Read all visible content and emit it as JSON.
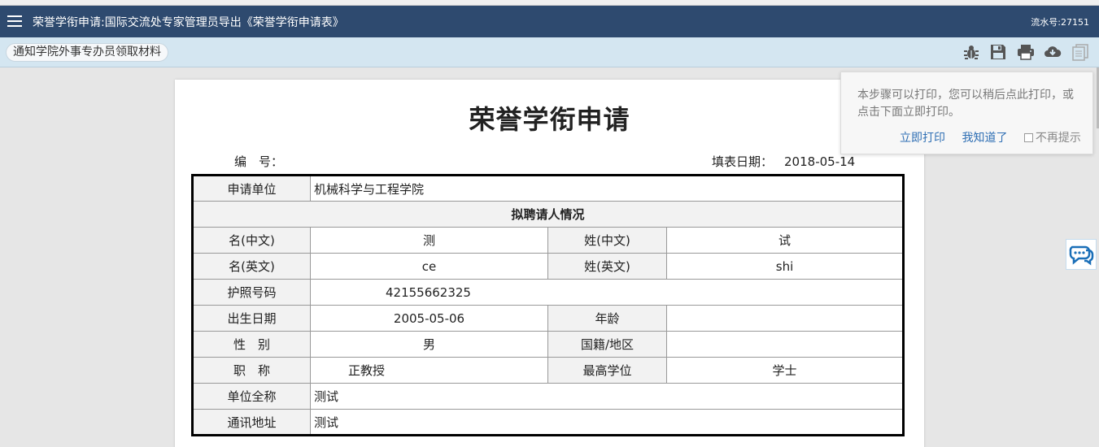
{
  "window": {
    "title": "荣誉学衔申请:国际交流处专家管理员导出《荣誉学衔申请表》",
    "serial": "流水号:27151"
  },
  "toolbar": {
    "notify_label": "通知学院外事专办员领取材料",
    "icons": [
      "bug-icon",
      "save-icon",
      "print-icon",
      "cloud-download-icon",
      "history-icon"
    ]
  },
  "document": {
    "title": "荣誉学衔申请",
    "number_label": "编　号：",
    "number_value": "",
    "date_label": "填表日期：",
    "date_value": "2018-05-14"
  },
  "form": {
    "unit_label": "申请单位",
    "unit_value": "机械科学与工程学院",
    "section_title": "拟聘请人情况",
    "given_cn_label": "名(中文)",
    "given_cn_value": "测",
    "family_cn_label": "姓(中文)",
    "family_cn_value": "试",
    "given_en_label": "名(英文)",
    "given_en_value": "ce",
    "family_en_label": "姓(英文)",
    "family_en_value": "shi",
    "passport_label": "护照号码",
    "passport_value": "42155662325",
    "birth_label": "出生日期",
    "birth_value": "2005-05-06",
    "age_label": "年龄",
    "age_value": "",
    "gender_label": "性　别",
    "gender_value": "男",
    "nationality_label": "国籍/地区",
    "nationality_value": "",
    "title_label": "职　称",
    "title_value": "正教授",
    "degree_label": "最高学位",
    "degree_value": "学士",
    "org_label": "单位全称",
    "org_value": "测试",
    "address_label": "通讯地址",
    "address_value": "测试"
  },
  "popup": {
    "message": "本步骤可以打印，您可以稍后点此打印，或点击下面立即打印。",
    "print_now": "立即打印",
    "got_it": "我知道了",
    "no_more": "不再提示"
  },
  "colors": {
    "titlebar": "#2e4a6f",
    "toolbar": "#d4e6f1",
    "link": "#2f6fb4"
  }
}
